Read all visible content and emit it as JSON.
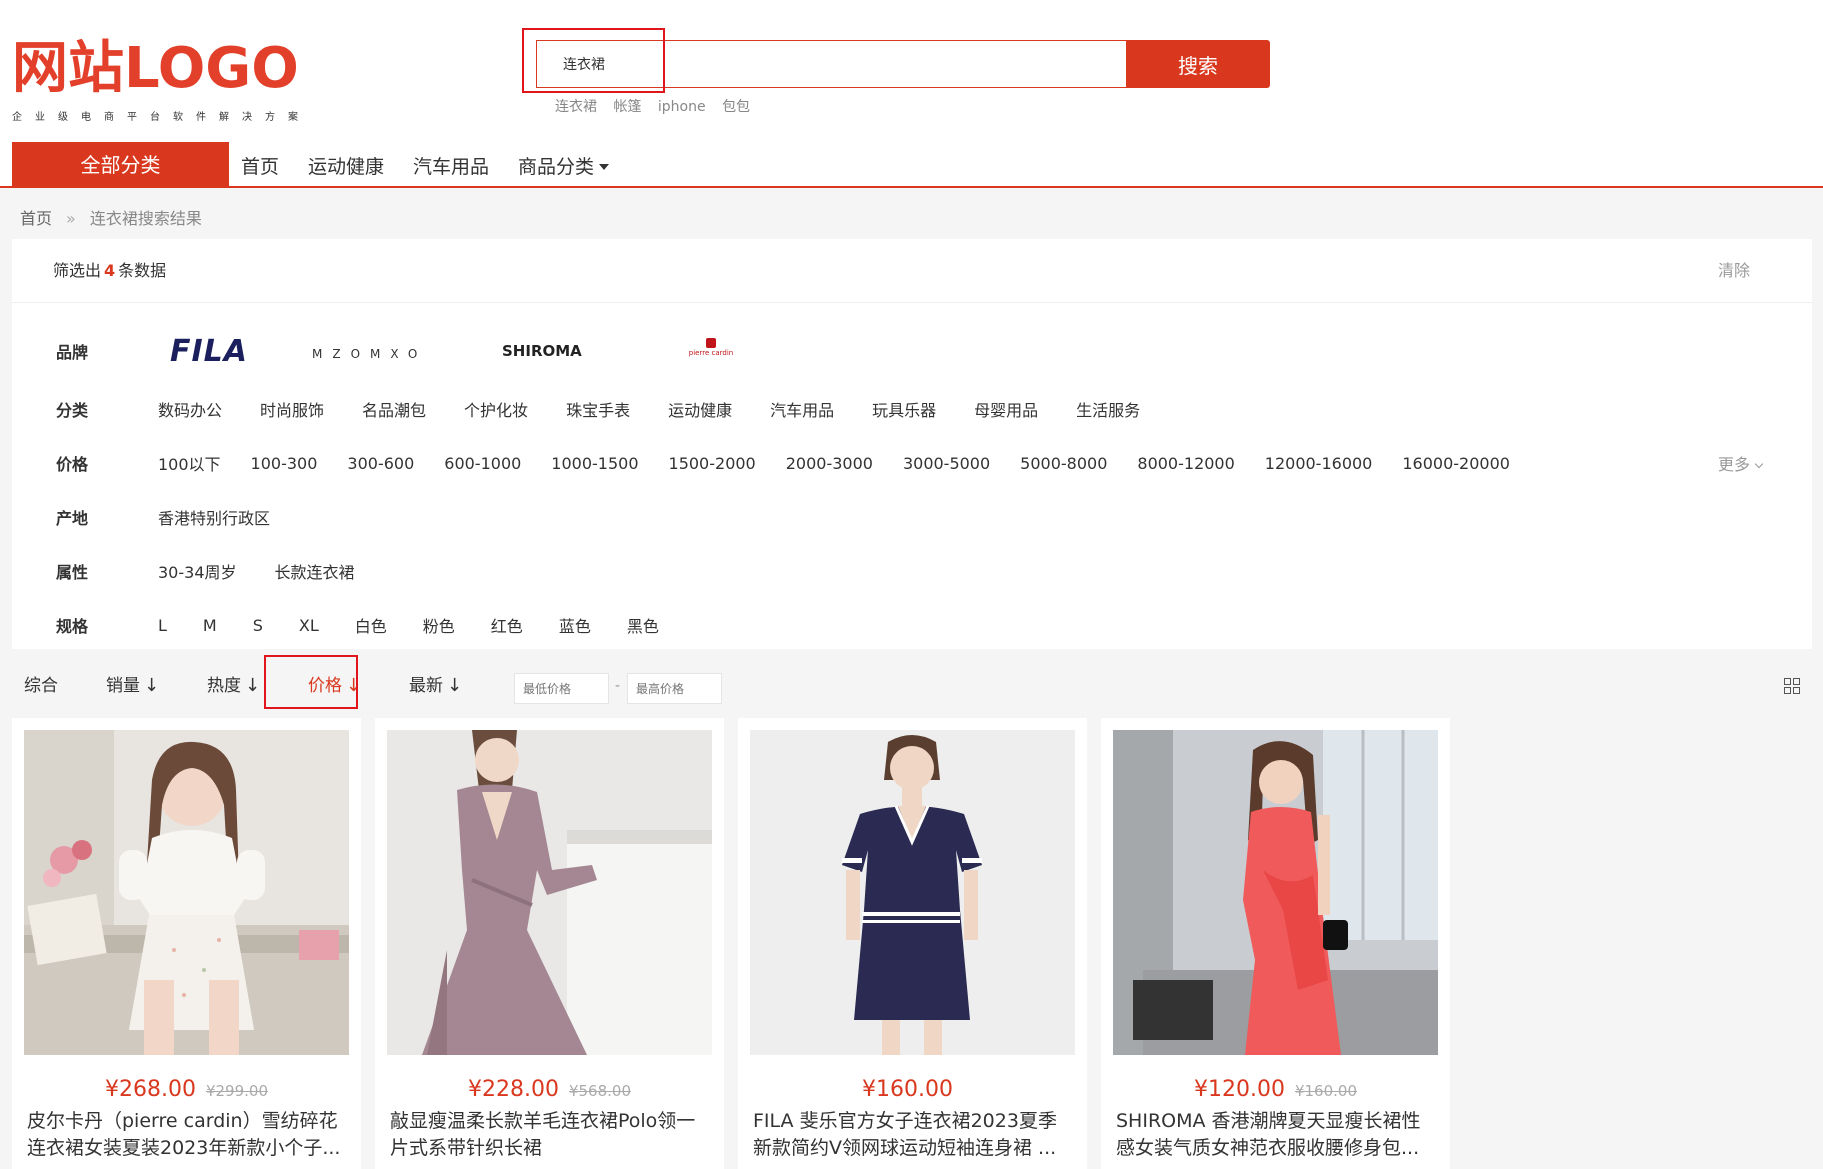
{
  "header": {
    "logo_text": "网站LOGO",
    "logo_slogan": "企业级电商平台软件解决方案",
    "search": {
      "value": "连衣裙",
      "button_label": "搜索"
    },
    "hot_words": [
      "连衣裙",
      "帐篷",
      "iphone",
      "包包"
    ]
  },
  "nav": {
    "all_categories": "全部分类",
    "items": [
      "首页",
      "运动健康",
      "汽车用品",
      "商品分类"
    ]
  },
  "breadcrumb": {
    "home": "首页",
    "separator": "»",
    "current": "连衣裙搜索结果"
  },
  "filter": {
    "summary_prefix": "筛选出",
    "count": "4",
    "summary_suffix": "条数据",
    "clear_label": "清除",
    "brand_label": "品牌",
    "brands": [
      "FILA",
      "MZOMXO",
      "SHIROMA",
      "pierre cardin"
    ],
    "category_label": "分类",
    "categories": [
      "数码办公",
      "时尚服饰",
      "名品潮包",
      "个护化妆",
      "珠宝手表",
      "运动健康",
      "汽车用品",
      "玩具乐器",
      "母婴用品",
      "生活服务"
    ],
    "price_label": "价格",
    "prices": [
      "100以下",
      "100-300",
      "300-600",
      "600-1000",
      "1000-1500",
      "1500-2000",
      "2000-3000",
      "3000-5000",
      "5000-8000",
      "8000-12000",
      "12000-16000",
      "16000-20000"
    ],
    "more_label": "更多",
    "origin_label": "产地",
    "origins": [
      "香港特别行政区"
    ],
    "attribute_label": "属性",
    "attributes": [
      "30-34周岁",
      "长款连衣裙"
    ],
    "spec_label": "规格",
    "specs": [
      "L",
      "M",
      "S",
      "XL",
      "白色",
      "粉色",
      "红色",
      "蓝色",
      "黑色"
    ]
  },
  "sort": {
    "items": [
      "综合",
      "销量",
      "热度",
      "价格",
      "最新"
    ],
    "arrow": "↓",
    "min_price_placeholder": "最低价格",
    "max_price_placeholder": "最高价格",
    "dash": "-"
  },
  "products": [
    {
      "price": "¥268.00",
      "old_price": "¥299.00",
      "title_line1": "皮尔卡丹（pierre cardin）雪纺碎花",
      "title_line2": "连衣裙女装夏装2023年新款小个子..."
    },
    {
      "price": "¥228.00",
      "old_price": "¥568.00",
      "title_line1": "敲显瘦温柔长款羊毛连衣裙Polo领一",
      "title_line2": "片式系带针织长裙"
    },
    {
      "price": "¥160.00",
      "old_price": "",
      "title_line1": "FILA 斐乐官方女子连衣裙2023夏季",
      "title_line2": "新款简约V领网球运动短袖连身裙 ..."
    },
    {
      "price": "¥120.00",
      "old_price": "¥160.00",
      "title_line1": "SHIROMA 香港潮牌夏天显瘦长裙性",
      "title_line2": "感女装气质女神范衣服收腰修身包..."
    }
  ],
  "colors": {
    "accent": "#d9381e",
    "highlight_box": "#e0161c",
    "fila_navy": "#1b1f5e"
  },
  "icons": [
    "caret-down-icon",
    "chevron-down-icon",
    "grid-view-icon",
    "sort-arrow-icon"
  ]
}
